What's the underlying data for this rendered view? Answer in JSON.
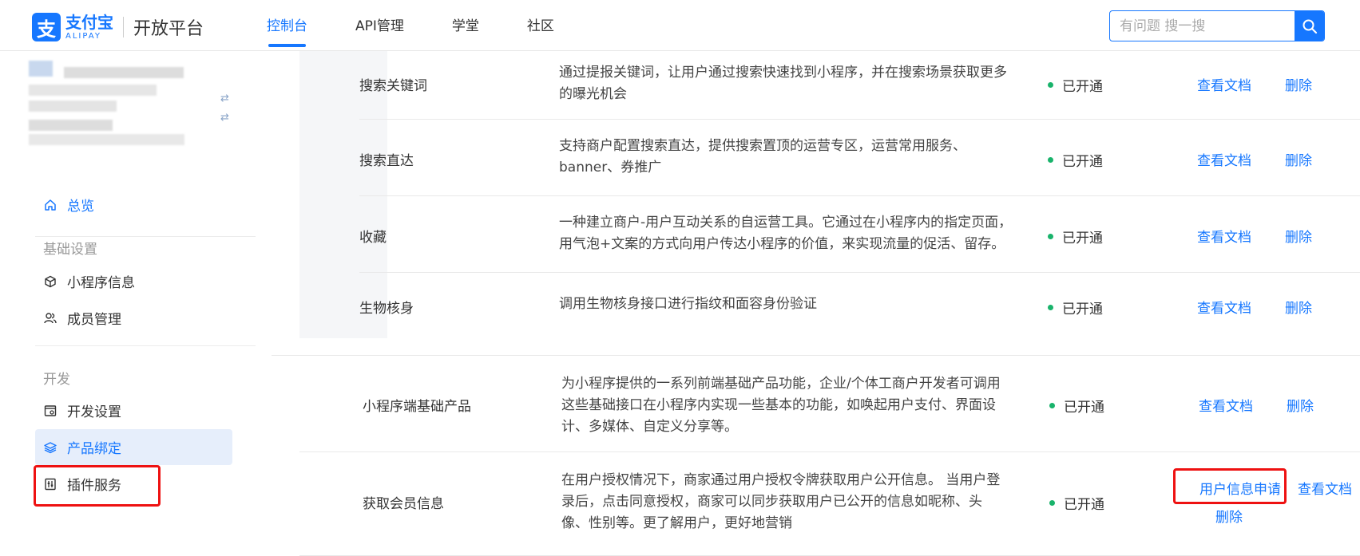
{
  "header": {
    "logo": {
      "cn": "支付宝",
      "en": "ALIPAY",
      "platform": "开放平台",
      "mark": "支"
    },
    "nav": [
      {
        "label": "控制台",
        "active": true
      },
      {
        "label": "API管理",
        "active": false
      },
      {
        "label": "学堂",
        "active": false
      },
      {
        "label": "社区",
        "active": false
      }
    ],
    "search": {
      "placeholder": "有问题 搜一搜"
    }
  },
  "sidebar": {
    "overview": "总览",
    "groups": [
      {
        "title": "基础设置",
        "items": [
          "小程序信息",
          "成员管理"
        ]
      },
      {
        "title": "开发",
        "items": [
          "开发设置",
          "产品绑定",
          "插件服务"
        ]
      }
    ],
    "active_item": "产品绑定",
    "swap_icon": "⇄"
  },
  "products": [
    {
      "name": "搜索关键词",
      "desc": "通过提报关键词，让用户通过搜索快速找到小程序，并在搜索场景获取更多的曝光机会",
      "status": "已开通",
      "actions": [
        "查看文档",
        "删除"
      ]
    },
    {
      "name": "搜索直达",
      "desc": "支持商户配置搜索直达，提供搜索置顶的运营专区，运营常用服务、banner、券推广",
      "status": "已开通",
      "actions": [
        "查看文档",
        "删除"
      ]
    },
    {
      "name": "收藏",
      "desc": "一种建立商户-用户互动关系的自运营工具。它通过在小程序内的指定页面，用气泡+文案的方式向用户传达小程序的价值，来实现流量的促活、留存。",
      "status": "已开通",
      "actions": [
        "查看文档",
        "删除"
      ]
    },
    {
      "name": "生物核身",
      "desc": "调用生物核身接口进行指纹和面容身份验证",
      "status": "已开通",
      "actions": [
        "查看文档",
        "删除"
      ]
    },
    {
      "name": "小程序端基础产品",
      "desc": "为小程序提供的一系列前端基础产品功能，企业/个体工商户开发者可调用这些基础接口在小程序内实现一些基本的功能，如唤起用户支付、界面设计、多媒体、自定义分享等。",
      "status": "已开通",
      "actions": [
        "查看文档",
        "删除"
      ]
    },
    {
      "name": "获取会员信息",
      "desc": "在用户授权情况下，商家通过用户授权令牌获取用户公开信息。 当用户登录后，点击同意授权，商家可以同步获取用户已公开的信息如昵称、头像、性别等。更了解用户，更好地营销",
      "status": "已开通",
      "actions": [
        "用户信息申请",
        "查看文档",
        "删除"
      ]
    }
  ],
  "colors": {
    "accent": "#1677ff",
    "status_dot": "#19b36b",
    "highlight_box": "#ee1111"
  }
}
